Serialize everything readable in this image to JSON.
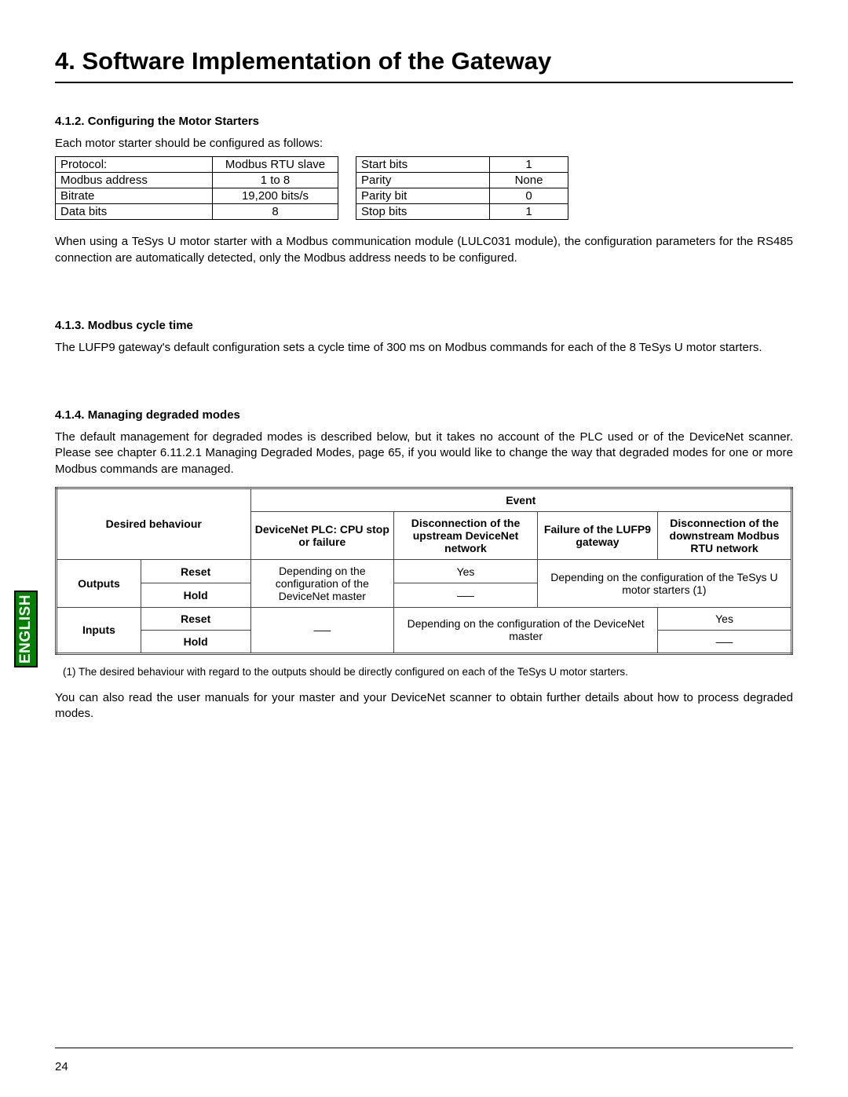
{
  "chapter_title": "4. Software Implementation of the Gateway",
  "s412": {
    "heading": "4.1.2. Configuring the Motor Starters",
    "intro": "Each motor starter should be configured as follows:",
    "table_left": [
      {
        "label": "Protocol:",
        "value": "Modbus RTU slave"
      },
      {
        "label": "Modbus address",
        "value": "1 to 8"
      },
      {
        "label": "Bitrate",
        "value": "19,200 bits/s"
      },
      {
        "label": "Data bits",
        "value": "8"
      }
    ],
    "table_right": [
      {
        "label": "Start bits",
        "value": "1"
      },
      {
        "label": "Parity",
        "value": "None"
      },
      {
        "label": "Parity bit",
        "value": "0"
      },
      {
        "label": "Stop bits",
        "value": "1"
      }
    ],
    "para": "When using a TeSys U motor starter with a Modbus communication module (LULC031 module), the configuration parameters for the RS485 connection are automatically detected, only the Modbus address needs to be configured."
  },
  "s413": {
    "heading": "4.1.3. Modbus cycle time",
    "para": "The LUFP9 gateway's default configuration sets a cycle time of 300 ms on Modbus commands for each of the 8 TeSys U motor starters."
  },
  "s414": {
    "heading": "4.1.4. Managing degraded modes",
    "para": "The default management for degraded modes is described below, but it takes no account of the PLC used or of the DeviceNet scanner. Please see chapter 6.11.2.1 Managing Degraded Modes, page 65, if you would like to change the way that degraded modes for one or more Modbus commands are managed.",
    "table": {
      "header_event": "Event",
      "header_behaviour": "Desired behaviour",
      "header_cols": [
        "DeviceNet PLC:\nCPU stop or failure",
        "Disconnection of the upstream DeviceNet network",
        "Failure of the LUFP9 gateway",
        "Disconnection of the downstream Modbus RTU network"
      ],
      "rows_left": {
        "outputs": "Outputs",
        "inputs": "Inputs",
        "reset": "Reset",
        "hold": "Hold"
      },
      "cells": {
        "out_col1": "Depending on the configuration of the DeviceNet master",
        "out_reset_col2": "Yes",
        "out_hold_col2": "—–",
        "out_cols34": "Depending on the configuration of the TeSys U motor starters (1)",
        "in_col1": "—–",
        "in_cols23": "Depending on the configuration of the DeviceNet master",
        "in_reset_col4": "Yes",
        "in_hold_col4": "—–"
      }
    },
    "footnote": "(1)   The desired behaviour with regard to the outputs should be directly configured on each of the TeSys U motor starters.",
    "closing": "You can also read the user manuals for your master and your DeviceNet scanner to obtain further details about how to process degraded modes."
  },
  "language_tab": "ENGLISH",
  "page_number": "24"
}
